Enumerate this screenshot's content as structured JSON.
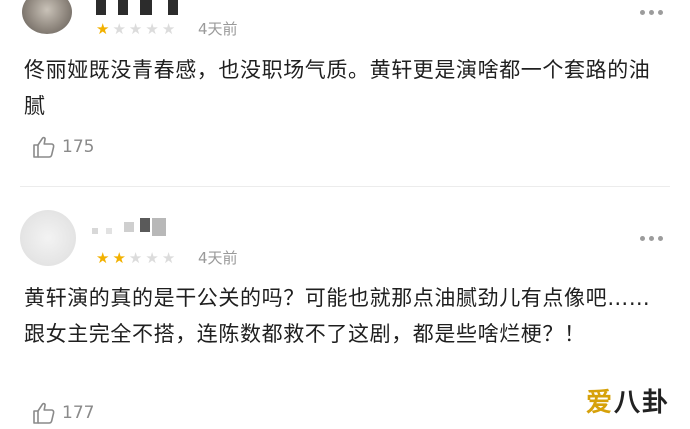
{
  "comments": [
    {
      "rating": 1,
      "max_rating": 5,
      "time": "4天前",
      "text": "佟丽娅既没青春感，也没职场气质。黄轩更是演啥都一个套路的油腻",
      "likes": "175",
      "like_icon": "thumbs-up-icon",
      "more_icon": "more-dots-icon"
    },
    {
      "rating": 2,
      "max_rating": 5,
      "time": "4天前",
      "text": "黄轩演的真的是干公关的吗？可能也就那点油腻劲儿有点像吧……跟女主完全不搭，连陈数都救不了这剧，都是些啥烂梗？！",
      "likes": "177",
      "like_icon": "thumbs-up-icon",
      "more_icon": "more-dots-icon"
    }
  ],
  "watermark": {
    "part1": "爱",
    "part2": "八卦"
  },
  "colors": {
    "star_on": "#f2b100",
    "star_off": "#dcdcdc",
    "muted": "#9a9a9a"
  }
}
